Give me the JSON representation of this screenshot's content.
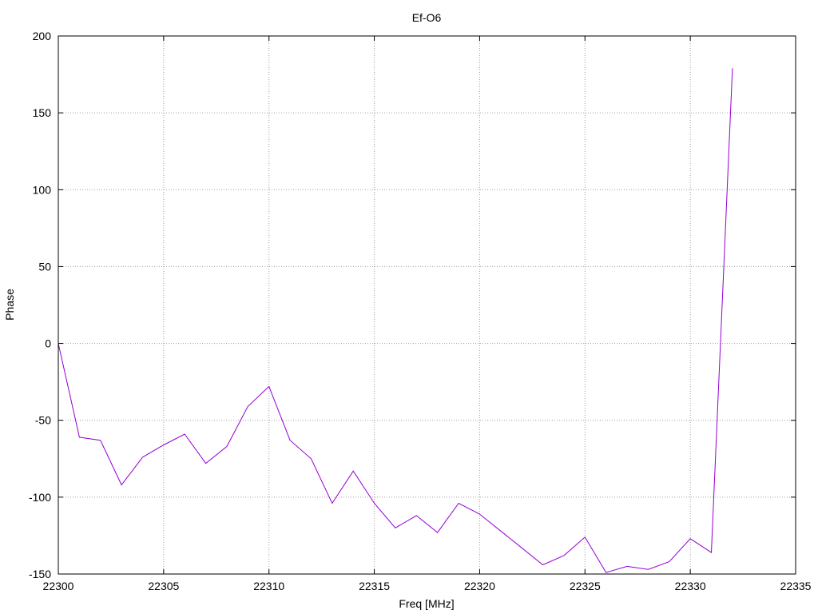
{
  "chart_data": {
    "type": "line",
    "title": "Ef-O6",
    "xlabel": "Freq [MHz]",
    "ylabel": "Phase",
    "xlim": [
      22300,
      22335
    ],
    "ylim": [
      -150,
      200
    ],
    "xticks": [
      22300,
      22305,
      22310,
      22315,
      22320,
      22325,
      22330,
      22335
    ],
    "yticks": [
      -150,
      -100,
      -50,
      0,
      50,
      100,
      150,
      200
    ],
    "grid": true,
    "series": [
      {
        "color": "#9400d3",
        "x": [
          22300,
          22301,
          22302,
          22303,
          22304,
          22305,
          22306,
          22307,
          22308,
          22309,
          22310,
          22311,
          22312,
          22313,
          22314,
          22315,
          22316,
          22317,
          22318,
          22319,
          22320,
          22321,
          22322,
          22323,
          22324,
          22325,
          22326,
          22327,
          22328,
          22329,
          22330,
          22331,
          22332
        ],
        "y": [
          0,
          -61,
          -63,
          -92,
          -74,
          -66,
          -59,
          -78,
          -67,
          -41,
          -28,
          -63,
          -75,
          -104,
          -83,
          -104,
          -120,
          -112,
          -123,
          -104,
          -111,
          -122,
          -133,
          -144,
          -138,
          -126,
          -149,
          -145,
          -147,
          -142,
          -127,
          -136,
          179
        ]
      }
    ]
  }
}
